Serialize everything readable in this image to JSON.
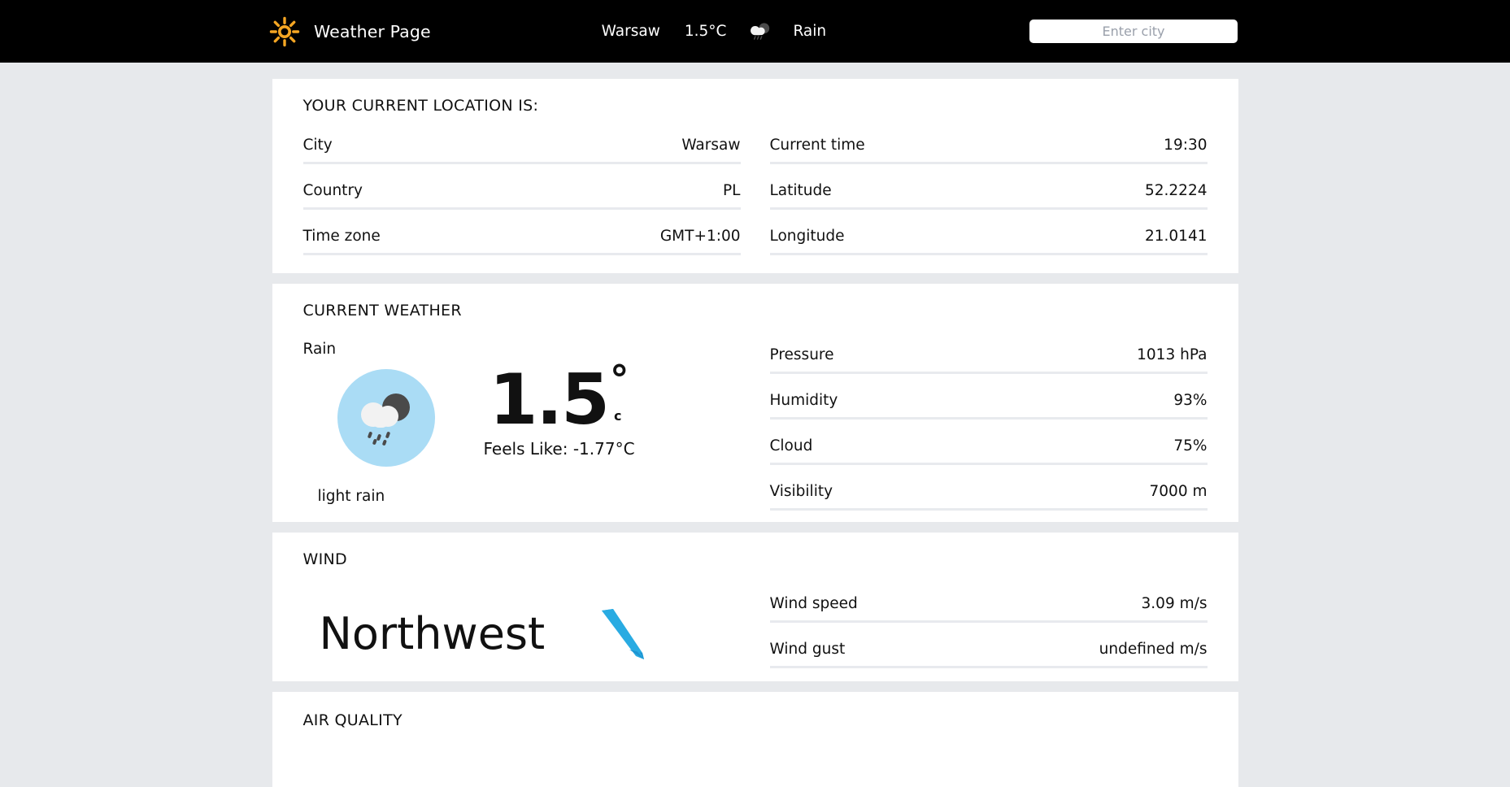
{
  "header": {
    "logo_icon": "sun-icon",
    "brand_title": "Weather Page",
    "current_city": "Warsaw",
    "current_temp": "1.5°C",
    "current_condition_icon": "rain-cloud-icon",
    "current_condition": "Rain",
    "search_placeholder": "Enter city",
    "search_value": ""
  },
  "location_card": {
    "heading": "YOUR CURRENT LOCATION IS:",
    "left_rows": [
      {
        "label": "City",
        "value": "Warsaw"
      },
      {
        "label": "Country",
        "value": "PL"
      },
      {
        "label": "Time zone",
        "value": "GMT+1:00"
      }
    ],
    "right_rows": [
      {
        "label": "Current time",
        "value": "19:30"
      },
      {
        "label": "Latitude",
        "value": "52.2224"
      },
      {
        "label": "Longitude",
        "value": "21.0141"
      }
    ]
  },
  "current_weather": {
    "heading": "CURRENT WEATHER",
    "condition": "Rain",
    "condition_icon": "rain-cloud-icon",
    "temperature": "1.5",
    "degree_symbol": "°",
    "unit": "c",
    "feels_like": "Feels Like: -1.77°C",
    "description": "light rain",
    "stats": [
      {
        "label": "Pressure",
        "value": "1013 hPa"
      },
      {
        "label": "Humidity",
        "value": "93%"
      },
      {
        "label": "Cloud",
        "value": "75%"
      },
      {
        "label": "Visibility",
        "value": "7000 m"
      }
    ]
  },
  "wind": {
    "heading": "WIND",
    "direction": "Northwest",
    "direction_icon": "arrow-down-right-icon",
    "stats": [
      {
        "label": "Wind speed",
        "value": "3.09 m/s"
      },
      {
        "label": "Wind gust",
        "value": "undefined m/s"
      }
    ]
  },
  "air_quality": {
    "heading": "AIR QUALITY"
  },
  "colors": {
    "navbar_bg": "#000000",
    "page_bg": "#e7e9ec",
    "card_bg": "#ffffff",
    "accent_orange": "#f5a623",
    "rain_badge_bg": "#aadcf5",
    "arrow_blue": "#29abe2",
    "divider": "#e8eaee"
  }
}
